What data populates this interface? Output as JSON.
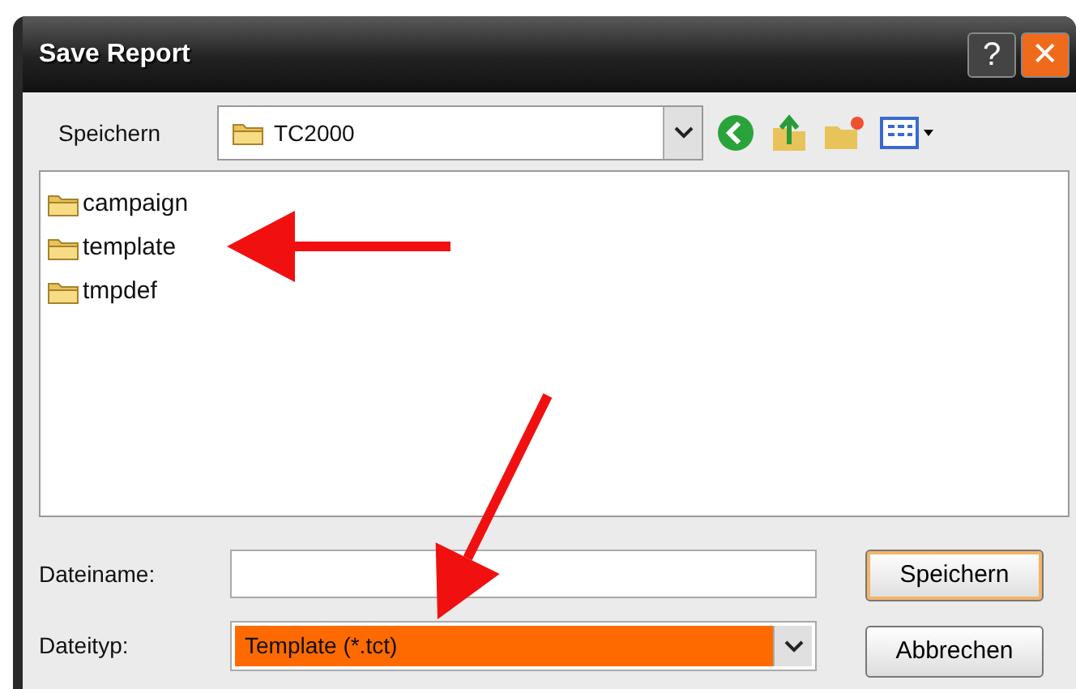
{
  "window": {
    "title": "Save Report",
    "help": "?",
    "close": "✕"
  },
  "toolbar": {
    "label": "Speichern",
    "location": "TC2000"
  },
  "files": [
    {
      "name": "campaign"
    },
    {
      "name": "template"
    },
    {
      "name": "tmpdef"
    }
  ],
  "fields": [
    {
      "label": "Dateiname:",
      "kind": "text",
      "highlighted": false
    },
    {
      "label": "Dateityp:",
      "kind": "dropdown",
      "value": "Template (*.tct)",
      "highlighted": true
    }
  ],
  "buttons": [
    {
      "label": "Speichern",
      "default": true
    },
    {
      "label": "Abbrechen",
      "default": false
    }
  ]
}
